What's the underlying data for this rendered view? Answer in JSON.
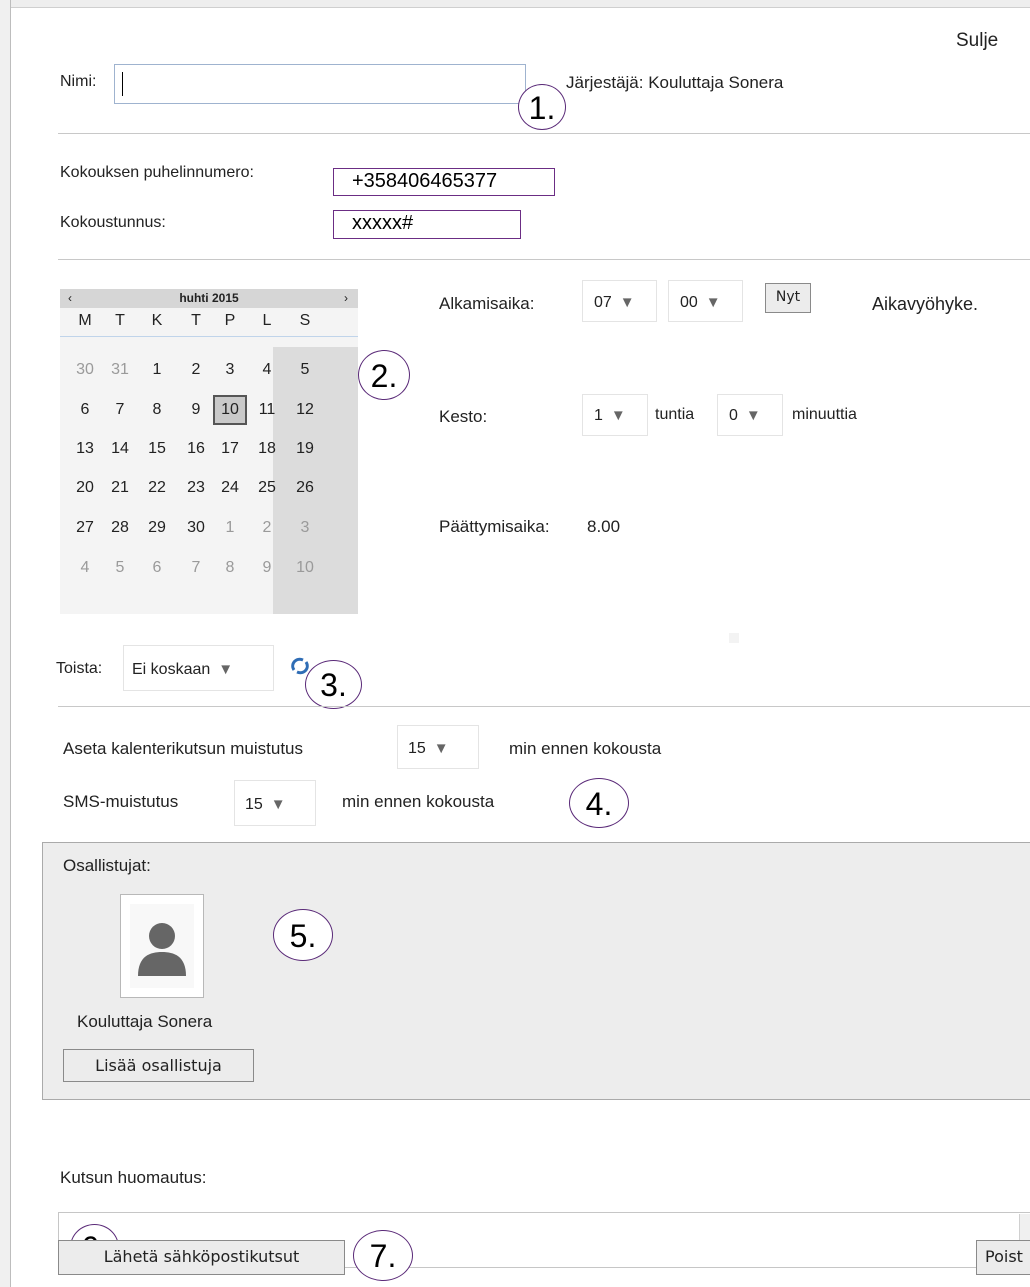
{
  "header": {
    "close_label": "Sulje"
  },
  "name_row": {
    "name_label": "Nimi:",
    "name_value": "",
    "organizer_text": "Järjestäjä: Kouluttaja Sonera"
  },
  "phone": {
    "phone_label": "Kokouksen puhelinnumero:",
    "phone_value": "+358406465377",
    "code_label": "Kokoustunnus:",
    "code_value": "xxxxx#"
  },
  "calendar": {
    "prev": "‹",
    "next": "›",
    "month_title": "huhti 2015",
    "weekdays": [
      "M",
      "T",
      "K",
      "T",
      "P",
      "L",
      "S"
    ],
    "weeks": [
      [
        "30",
        "31",
        "1",
        "2",
        "3",
        "4",
        "5"
      ],
      [
        "6",
        "7",
        "8",
        "9",
        "10",
        "11",
        "12"
      ],
      [
        "13",
        "14",
        "15",
        "16",
        "17",
        "18",
        "19"
      ],
      [
        "20",
        "21",
        "22",
        "23",
        "24",
        "25",
        "26"
      ],
      [
        "27",
        "28",
        "29",
        "30",
        "1",
        "2",
        "3"
      ],
      [
        "4",
        "5",
        "6",
        "7",
        "8",
        "9",
        "10"
      ]
    ],
    "selected_day": "10"
  },
  "time": {
    "start_label": "Alkamisaika:",
    "start_hour": "07",
    "start_minute": "00",
    "now_button": "Nyt",
    "timezone_label": "Aikavyöhyke.",
    "duration_label": "Kesto:",
    "duration_hours": "1",
    "hours_unit": "tuntia",
    "duration_minutes": "0",
    "minutes_unit": "minuuttia",
    "end_label": "Päättymisaika:",
    "end_value": "8.00"
  },
  "repeat": {
    "label": "Toista:",
    "value": "Ei koskaan"
  },
  "reminders": {
    "calendar_label": "Aseta kalenterikutsun muistutus",
    "calendar_value": "15",
    "calendar_suffix": "min ennen kokousta",
    "sms_label": "SMS-muistutus",
    "sms_value": "15",
    "sms_suffix": "min ennen kokousta"
  },
  "participants": {
    "title": "Osallistujat:",
    "name": "Kouluttaja Sonera",
    "add_button": "Lisää osallistuja"
  },
  "note": {
    "label": "Kutsun huomautus:"
  },
  "footer": {
    "send_button": "Lähetä sähköpostikutsut",
    "delete_button": "Poist"
  },
  "callouts": [
    "1.",
    "2.",
    "3.",
    "4.",
    "5.",
    "6.",
    "7."
  ],
  "colors": {
    "callout_border": "#5a2a78",
    "highlight_border": "#6b2d84",
    "calendar_header": "#d6d6d6"
  }
}
